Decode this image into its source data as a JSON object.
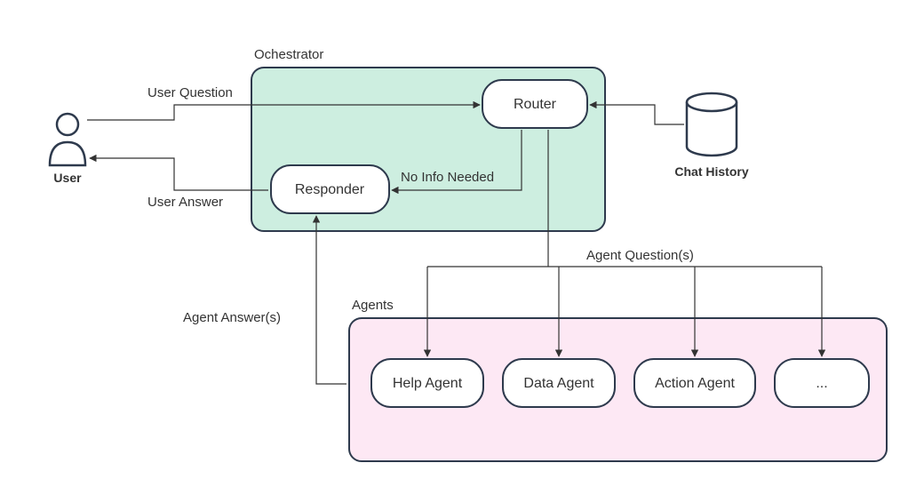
{
  "groups": {
    "orchestrator": {
      "label": "Ochestrator"
    },
    "agents": {
      "label": "Agents"
    }
  },
  "nodes": {
    "router": {
      "label": "Router"
    },
    "responder": {
      "label": "Responder"
    },
    "help_agent": {
      "label": "Help Agent"
    },
    "data_agent": {
      "label": "Data Agent"
    },
    "action_agent": {
      "label": "Action Agent"
    },
    "more_agent": {
      "label": "..."
    }
  },
  "external": {
    "user": {
      "label": "User"
    },
    "chat_history": {
      "label": "Chat History"
    }
  },
  "edges": {
    "user_question": {
      "label": "User Question"
    },
    "user_answer": {
      "label": "User Answer"
    },
    "no_info": {
      "label": "No Info Needed"
    },
    "agent_questions": {
      "label": "Agent Question(s)"
    },
    "agent_answers": {
      "label": "Agent Answer(s)"
    }
  }
}
